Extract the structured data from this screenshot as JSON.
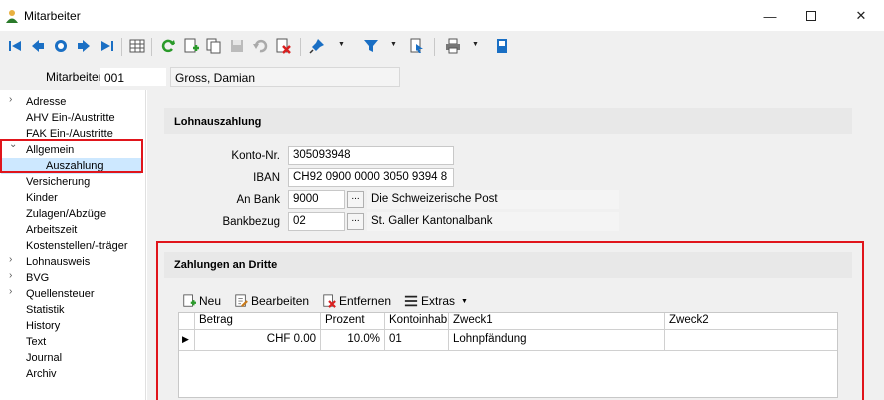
{
  "window": {
    "title": "Mitarbeiter",
    "min_icon": "minimize-icon",
    "max_icon": "maximize-icon",
    "close_icon": "close-icon"
  },
  "toolbar": {
    "icons": [
      "first-record-icon",
      "previous-record-icon",
      "search-icon",
      "next-record-icon",
      "last-record-icon",
      "table-view-icon",
      "refresh-icon",
      "new-record-icon",
      "copy-record-icon",
      "save-icon",
      "undo-icon",
      "delete-icon",
      "pin-icon",
      "filter-icon",
      "print-preview-icon",
      "print-icon",
      "settings-icon"
    ]
  },
  "employee": {
    "label": "Mitarbeiter",
    "number": "001",
    "name": "Gross, Damian"
  },
  "nav": {
    "items": [
      {
        "label": "Adresse",
        "chevron": "›"
      },
      {
        "label": "AHV Ein-/Austritte",
        "chevron": ""
      },
      {
        "label": "FAK Ein-/Austritte",
        "chevron": ""
      },
      {
        "label": "Allgemein",
        "chevron": "⌄"
      },
      {
        "label": "Auszahlung",
        "chevron": ""
      },
      {
        "label": "Versicherung",
        "chevron": ""
      },
      {
        "label": "Kinder",
        "chevron": ""
      },
      {
        "label": "Zulagen/Abzüge",
        "chevron": ""
      },
      {
        "label": "Arbeitszeit",
        "chevron": ""
      },
      {
        "label": "Kostenstellen/-träger",
        "chevron": ""
      },
      {
        "label": "Lohnausweis",
        "chevron": "›"
      },
      {
        "label": "BVG",
        "chevron": "›"
      },
      {
        "label": "Quellensteuer",
        "chevron": "›"
      },
      {
        "label": "Statistik",
        "chevron": ""
      },
      {
        "label": "History",
        "chevron": ""
      },
      {
        "label": "Text",
        "chevron": ""
      },
      {
        "label": "Journal",
        "chevron": ""
      },
      {
        "label": "Archiv",
        "chevron": ""
      }
    ]
  },
  "payout": {
    "title": "Lohnauszahlung",
    "konto_label": "Konto-Nr.",
    "konto_value": "305093948",
    "iban_label": "IBAN",
    "iban_value": "CH92 0900 0000 3050 9394 8",
    "bank_label": "An Bank",
    "bank_value": "9000",
    "bank_name": "Die Schweizerische Post",
    "bankbezug_label": "Bankbezug",
    "bankbezug_value": "02",
    "bankbezug_name": "St. Galler Kantonalbank",
    "lookup": "..."
  },
  "third": {
    "title": "Zahlungen an Dritte",
    "new_label": "Neu",
    "edit_label": "Bearbeiten",
    "remove_label": "Entfernen",
    "extras_label": "Extras",
    "columns": [
      "Betrag",
      "Prozent",
      "Kontoinhab",
      "Zweck1",
      "Zweck2"
    ],
    "rows": [
      {
        "betrag": "CHF 0.00",
        "prozent": "10.0%",
        "kontoinhab": "01",
        "zweck1": "Lohnpfändung",
        "zweck2": ""
      }
    ]
  },
  "colors": {
    "highlight": "#e0151b",
    "accent": "#1a6fc4",
    "selection": "#cde8ff"
  }
}
